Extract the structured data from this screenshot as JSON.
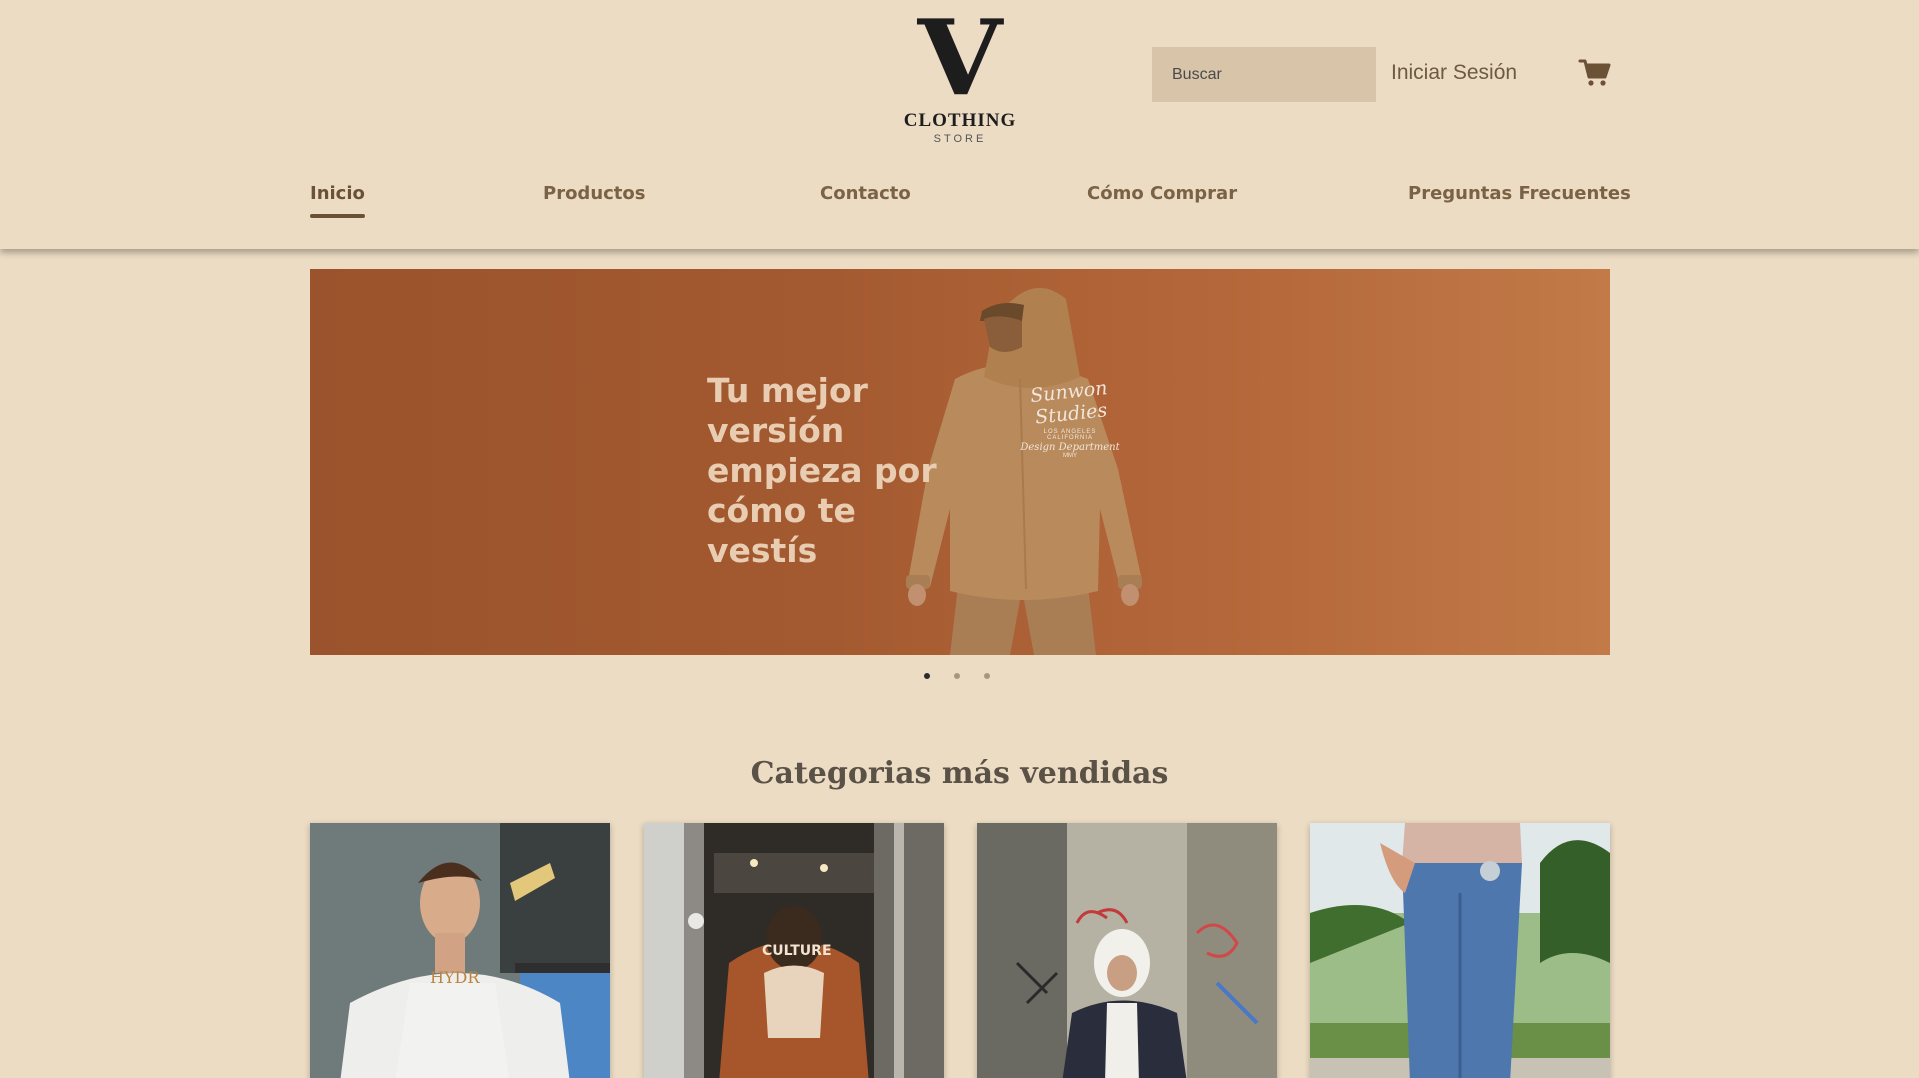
{
  "logo": {
    "letter": "V",
    "main": "CLOTHING",
    "sub": "STORE"
  },
  "search": {
    "placeholder": "Buscar",
    "value": ""
  },
  "header": {
    "login_label": "Iniciar Sesión",
    "cart_icon": "cart-icon"
  },
  "nav": {
    "items": [
      {
        "label": "Inicio",
        "active": true
      },
      {
        "label": "Productos",
        "active": false
      },
      {
        "label": "Contacto",
        "active": false
      },
      {
        "label": "Cómo Comprar",
        "active": false
      },
      {
        "label": "Preguntas Frecuentes",
        "active": false
      }
    ]
  },
  "banner": {
    "line1": "Tu mejor",
    "line2": "versión",
    "line3": "empieza por",
    "line4": "cómo te",
    "line5": "vestís",
    "hoodie_brand": "Sunwon Studies",
    "hoodie_line1": "LOS ANGELES",
    "hoodie_line2": "CALIFORNIA",
    "hoodie_line3": "Design Department",
    "hoodie_line4": "MMY"
  },
  "carousel": {
    "slide_count": 3,
    "active_index": 0
  },
  "categories": {
    "title": "Categorias más vendidas"
  },
  "colors": {
    "background": "#ecdcc4",
    "accent": "#6b5136",
    "nav_text": "#7b6244",
    "search_bg": "#d8c4a9",
    "banner": "#a45a30"
  }
}
